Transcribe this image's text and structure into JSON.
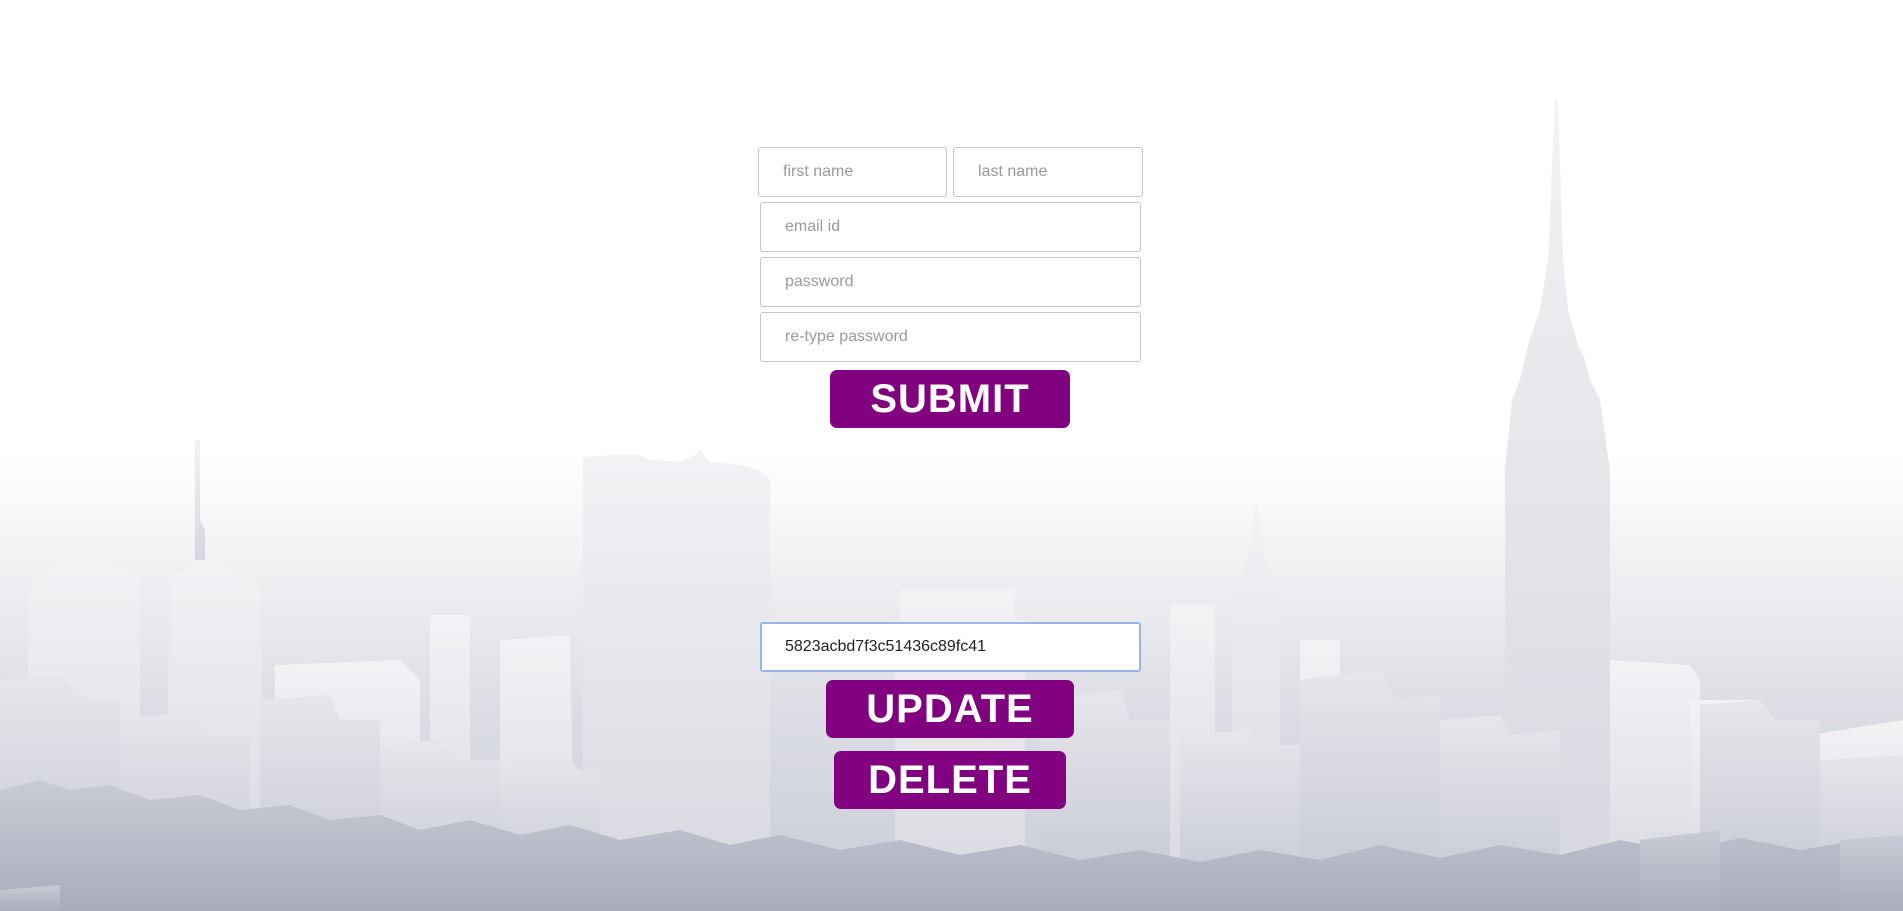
{
  "signup_form": {
    "first_name_placeholder": "first name",
    "last_name_placeholder": "last name",
    "email_placeholder": "email id",
    "password_placeholder": "password",
    "retype_password_placeholder": "re-type password",
    "submit_label": "SUBMIT"
  },
  "record_form": {
    "id_value": "5823acbd7f3c51436c89fc41",
    "update_label": "UPDATE",
    "delete_label": "DELETE"
  },
  "colors": {
    "button_background": "#800080",
    "button_text": "#ffffff",
    "focus_border": "#9bb5e8"
  }
}
